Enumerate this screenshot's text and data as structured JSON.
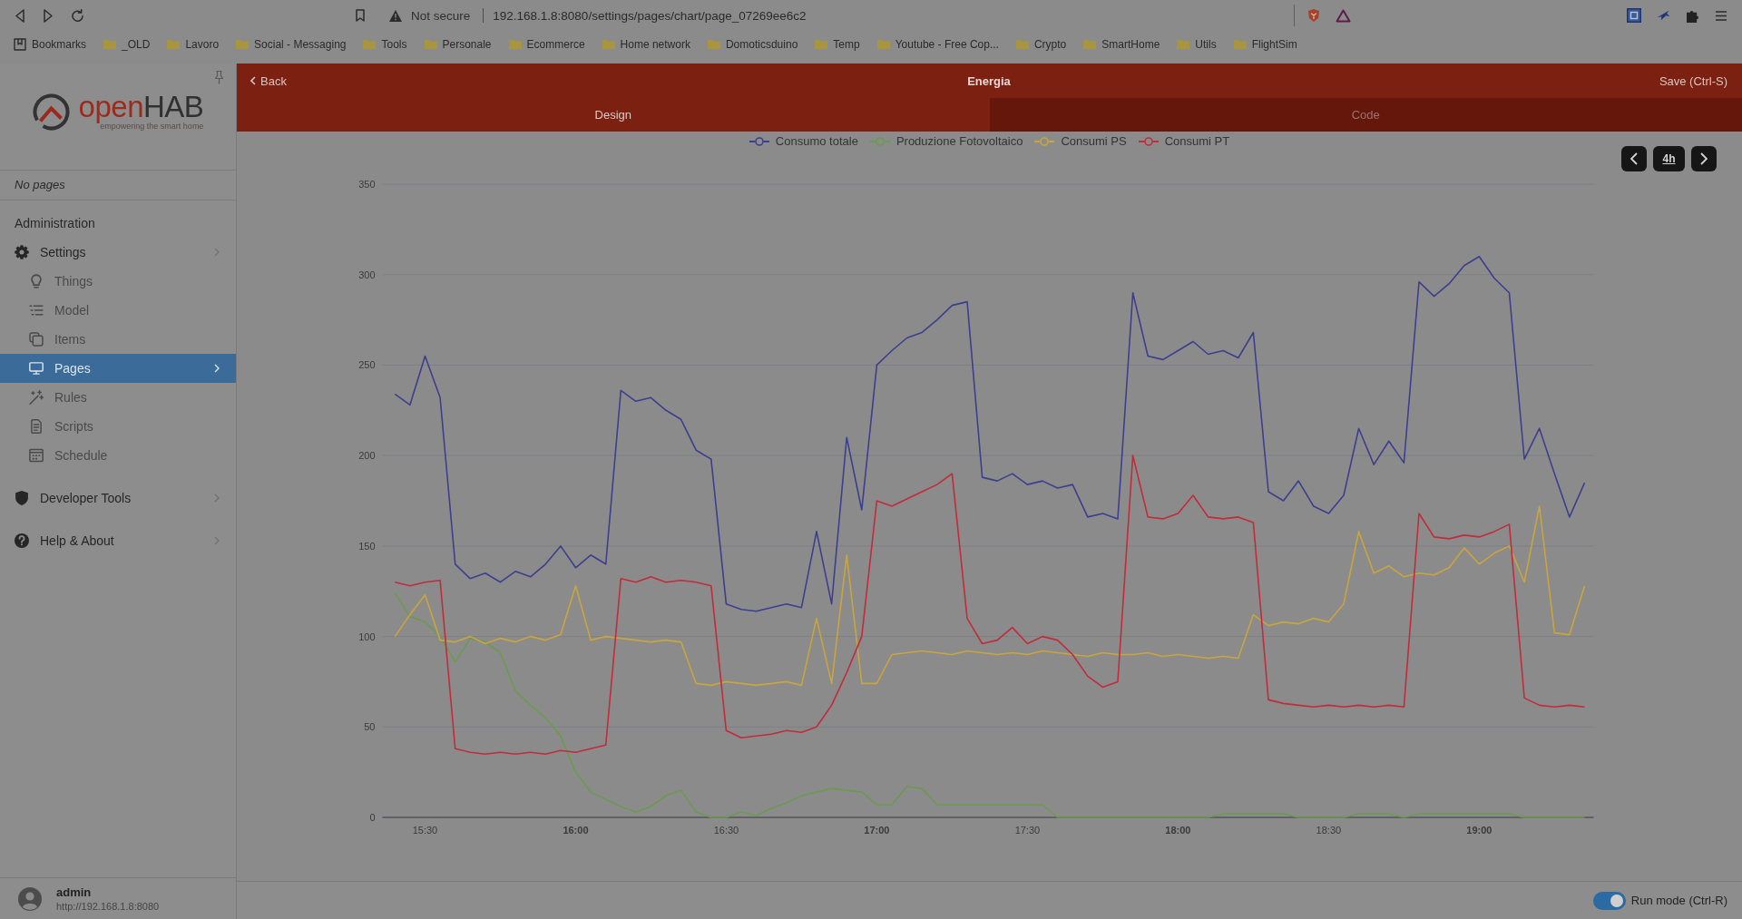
{
  "browser": {
    "security_label": "Not secure",
    "url": "192.168.1.8:8080/settings/pages/chart/page_07269ee6c2"
  },
  "bookmarks_bar": {
    "label": "Bookmarks",
    "folders": [
      "_OLD",
      "Lavoro",
      "Social - Messaging",
      "Tools",
      "Personale",
      "Ecommerce",
      "Home network",
      "Domoticsduino",
      "Temp",
      "Youtube - Free Cop...",
      "Crypto",
      "SmartHome",
      "Utils",
      "FlightSim"
    ]
  },
  "sidebar": {
    "logo": {
      "wordmark": [
        "open",
        "HAB"
      ],
      "tagline": "empowering the smart home"
    },
    "pages_placeholder": "No pages",
    "section_title": "Administration",
    "items": [
      {
        "label": "Settings",
        "selected": false,
        "children": [
          {
            "label": "Things",
            "selected": false
          },
          {
            "label": "Model",
            "selected": false
          },
          {
            "label": "Items",
            "selected": false
          },
          {
            "label": "Pages",
            "selected": true
          },
          {
            "label": "Rules",
            "selected": false
          },
          {
            "label": "Scripts",
            "selected": false
          },
          {
            "label": "Schedule",
            "selected": false
          }
        ]
      },
      {
        "label": "Developer Tools",
        "selected": false
      },
      {
        "label": "Help & About",
        "selected": false
      }
    ],
    "user": {
      "name": "admin",
      "server": "http://192.168.1.8:8080"
    }
  },
  "header": {
    "back_label": "Back",
    "title": "Energia",
    "save_label": "Save (Ctrl-S)"
  },
  "tabs": [
    {
      "label": "Design",
      "selected": true
    },
    {
      "label": "Code",
      "selected": false
    }
  ],
  "chart": {
    "range_label": "4h",
    "chart_data": {
      "type": "line",
      "legend": "top",
      "grid": true,
      "categories": [
        null,
        null,
        "15:30",
        null,
        null,
        null,
        null,
        null,
        null,
        null,
        null,
        null,
        "16:00",
        null,
        null,
        null,
        null,
        null,
        null,
        null,
        null,
        null,
        "16:30",
        null,
        null,
        null,
        null,
        null,
        null,
        null,
        null,
        null,
        "17:00",
        null,
        null,
        null,
        null,
        null,
        null,
        null,
        null,
        null,
        "17:30",
        null,
        null,
        null,
        null,
        null,
        null,
        null,
        null,
        null,
        "18:00",
        null,
        null,
        null,
        null,
        null,
        null,
        null,
        null,
        null,
        "18:30",
        null,
        null,
        null,
        null,
        null,
        null,
        null,
        null,
        null,
        "19:00",
        null,
        null,
        null,
        null,
        null,
        null,
        null
      ],
      "series": [
        {
          "name": "Consumo totale",
          "color": "#3d3f8e",
          "values": [
            234,
            228,
            255,
            232,
            140,
            132,
            135,
            130,
            136,
            133,
            140,
            150,
            138,
            145,
            140,
            236,
            230,
            232,
            225,
            220,
            203,
            198,
            118,
            115,
            114,
            116,
            118,
            116,
            158,
            118,
            210,
            170,
            250,
            258,
            265,
            268,
            275,
            283,
            285,
            188,
            186,
            190,
            184,
            186,
            182,
            184,
            166,
            168,
            165,
            290,
            255,
            253,
            258,
            263,
            256,
            258,
            254,
            268,
            180,
            175,
            186,
            172,
            168,
            178,
            215,
            195,
            208,
            196,
            296,
            288,
            295,
            305,
            310,
            298,
            290,
            198,
            215,
            190,
            166,
            185
          ]
        },
        {
          "name": "Produzione Fotovoltaico",
          "color": "#6c9a50",
          "values": [
            124,
            111,
            108,
            100,
            86,
            99,
            97,
            91,
            70,
            62,
            55,
            45,
            25,
            14,
            10,
            6,
            3,
            6,
            12,
            15,
            3,
            0,
            0,
            3,
            1,
            5,
            8,
            12,
            14,
            16,
            15,
            14,
            7,
            7,
            17,
            16,
            7,
            7,
            7,
            7,
            7,
            7,
            7,
            7,
            0,
            0,
            0,
            0,
            0,
            0,
            0,
            0,
            0,
            0,
            0,
            2,
            2,
            2,
            2,
            2,
            0,
            0,
            0,
            0,
            2,
            2,
            2,
            0,
            2,
            2,
            2,
            2,
            2,
            2,
            2,
            0,
            0,
            0,
            0,
            0
          ]
        },
        {
          "name": "Consumi PS",
          "color": "#c8a53e",
          "values": [
            100,
            112,
            123,
            98,
            97,
            100,
            96,
            99,
            97,
            100,
            98,
            101,
            128,
            98,
            100,
            99,
            98,
            97,
            98,
            97,
            74,
            73,
            75,
            74,
            73,
            74,
            75,
            73,
            110,
            74,
            145,
            74,
            74,
            90,
            91,
            92,
            91,
            90,
            92,
            91,
            90,
            91,
            90,
            92,
            91,
            90,
            89,
            91,
            90,
            90,
            91,
            89,
            90,
            89,
            88,
            89,
            88,
            112,
            106,
            108,
            107,
            110,
            108,
            118,
            158,
            135,
            139,
            133,
            135,
            134,
            138,
            149,
            140,
            146,
            150,
            130,
            172,
            102,
            101,
            128
          ]
        },
        {
          "name": "Consumi PT",
          "color": "#c22b3c",
          "values": [
            130,
            128,
            130,
            131,
            38,
            36,
            35,
            36,
            35,
            36,
            35,
            37,
            36,
            38,
            40,
            132,
            130,
            133,
            130,
            131,
            130,
            128,
            48,
            44,
            45,
            46,
            48,
            47,
            50,
            62,
            80,
            100,
            175,
            172,
            176,
            180,
            184,
            190,
            110,
            96,
            98,
            105,
            96,
            100,
            98,
            90,
            78,
            72,
            75,
            200,
            166,
            165,
            168,
            178,
            166,
            165,
            166,
            163,
            65,
            63,
            62,
            61,
            62,
            61,
            62,
            61,
            62,
            61,
            168,
            155,
            154,
            156,
            155,
            158,
            162,
            66,
            62,
            61,
            62,
            61
          ]
        }
      ],
      "ylim": [
        0,
        350
      ],
      "yticks": [
        0,
        50,
        100,
        150,
        200,
        250,
        300,
        350
      ]
    }
  },
  "footer": {
    "run_mode": {
      "label": "Run mode (Ctrl-R)",
      "on": true
    }
  }
}
